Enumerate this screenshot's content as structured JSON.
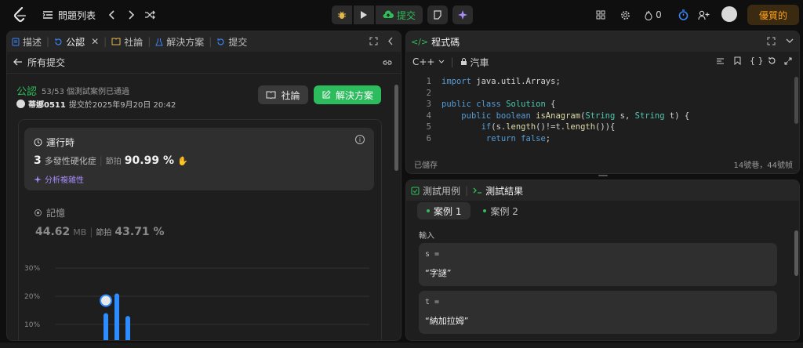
{
  "topbar": {
    "problem_list": "問題列表",
    "submit": "提交",
    "fire_count": "0",
    "premium": "優質的"
  },
  "left": {
    "tabs": [
      {
        "label": "描述"
      },
      {
        "label": "公認"
      },
      {
        "label": "社論"
      },
      {
        "label": "解決方案"
      },
      {
        "label": "提交"
      }
    ],
    "back_label": "所有提交",
    "status": "公認",
    "passed": "53/53 個測試案例已通過",
    "username": "蒂娜0511",
    "submitted_at": "提交於2025年9月20日 20:42",
    "btn_forum": "社論",
    "btn_solution": "解決方案",
    "runtime": {
      "title": "運行時",
      "value": "3",
      "unit": "多發性硬化症",
      "beats_label": "節拍",
      "beats_value": "90.99 %",
      "analyze": "分析複雜性"
    },
    "memory": {
      "title": "記憶",
      "value": "44.62",
      "unit": "MB",
      "beats_label": "節拍",
      "beats_value": "43.71 %"
    }
  },
  "chart_data": {
    "type": "bar",
    "yticks": [
      "30%",
      "20%",
      "10%"
    ],
    "ylim": [
      8,
      32
    ],
    "bars": [
      {
        "value": 14,
        "color": "#2f8cff"
      },
      {
        "value": 21,
        "color": "#2f8cff"
      },
      {
        "value": 13,
        "color": "#2f8cff"
      }
    ],
    "marker_bar": 0
  },
  "code": {
    "title": "程式碼",
    "language": "C++",
    "mode": "汽車",
    "saved": "已儲存",
    "position": "14號巷，44號帧",
    "lines": [
      "import java.util.Arrays;",
      "",
      "public class Solution {",
      "    public boolean isAnagram(String s, String t) {",
      "        if(s.length()!=t.length()){",
      "         return false;"
    ]
  },
  "test": {
    "tab_cases": "測試用例",
    "tab_results": "測試結果",
    "case1": "案例 1",
    "case2": "案例 2",
    "input_label": "輸入",
    "vars": [
      {
        "name": "s =",
        "value": "“字謎”"
      },
      {
        "name": "t =",
        "value": "“納加拉姆”"
      }
    ]
  }
}
